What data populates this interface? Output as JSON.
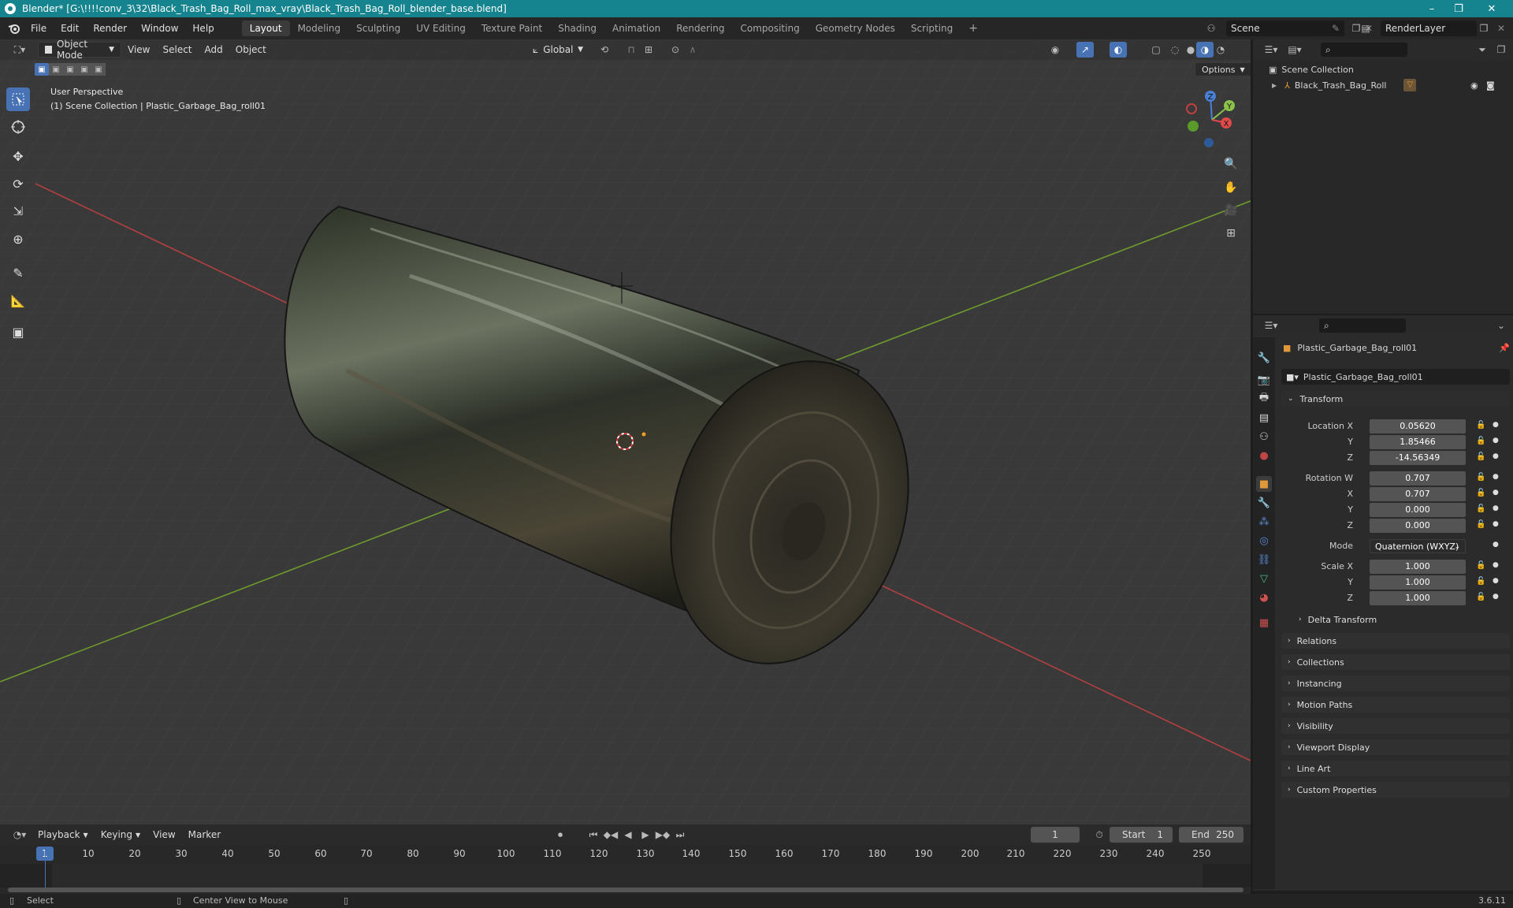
{
  "window": {
    "title": "Blender* [G:\\!!!!conv_3\\32\\Black_Trash_Bag_Roll_max_vray\\Black_Trash_Bag_Roll_blender_base.blend]",
    "minimize": "–",
    "maximize": "❐",
    "close": "✕"
  },
  "menus": [
    "File",
    "Edit",
    "Render",
    "Window",
    "Help"
  ],
  "workspaces": [
    "Layout",
    "Modeling",
    "Sculpting",
    "UV Editing",
    "Texture Paint",
    "Shading",
    "Animation",
    "Rendering",
    "Compositing",
    "Geometry Nodes",
    "Scripting"
  ],
  "workspace_add": "+",
  "scene": {
    "name": "Scene",
    "render_layer": "RenderLayer"
  },
  "viewport": {
    "mode": "Object Mode",
    "menus": [
      "View",
      "Select",
      "Add",
      "Object"
    ],
    "transform_orientation": "Global",
    "options": "Options",
    "perspective": "User Perspective",
    "collection_info": "(1) Scene Collection | Plastic_Garbage_Bag_roll01",
    "gizmo": {
      "x": "X",
      "y": "Y",
      "z": "Z"
    }
  },
  "outliner": {
    "root": "Scene Collection",
    "items": [
      {
        "label": "Black_Trash_Bag_Roll"
      }
    ]
  },
  "properties": {
    "object_name": "Plastic_Garbage_Bag_roll01",
    "object_name_field": "Plastic_Garbage_Bag_roll01",
    "transform": {
      "title": "Transform",
      "location_label": "Location X",
      "y_label": "Y",
      "z_label": "Z",
      "x_label": "X",
      "location": {
        "x": "0.05620",
        "y": "1.85466",
        "z": "-14.56349"
      },
      "rotation_label": "Rotation W",
      "rotation": {
        "w": "0.707",
        "x": "0.707",
        "y": "0.000",
        "z": "0.000"
      },
      "mode_label": "Mode",
      "mode": "Quaternion (WXYZ)",
      "scale_label": "Scale X",
      "scale": {
        "x": "1.000",
        "y": "1.000",
        "z": "1.000"
      },
      "delta": "Delta Transform"
    },
    "panels": [
      "Relations",
      "Collections",
      "Instancing",
      "Motion Paths",
      "Visibility",
      "Viewport Display",
      "Line Art",
      "Custom Properties"
    ]
  },
  "timeline": {
    "menus": [
      "Playback",
      "Keying",
      "View",
      "Marker"
    ],
    "current_frame": "1",
    "start_label": "Start",
    "start": "1",
    "end_label": "End",
    "end": "250",
    "ticks": [
      "1",
      "10",
      "20",
      "30",
      "40",
      "50",
      "60",
      "70",
      "80",
      "90",
      "100",
      "110",
      "120",
      "130",
      "140",
      "150",
      "160",
      "170",
      "180",
      "190",
      "200",
      "210",
      "220",
      "230",
      "240",
      "250"
    ]
  },
  "status": {
    "select": "Select",
    "center_view": "Center View to Mouse",
    "version": "3.6.11"
  },
  "colors": {
    "titlebar": "#15848f",
    "accent": "#4772b3",
    "x_axis": "#c04040",
    "y_axis": "#6f9a2d"
  }
}
